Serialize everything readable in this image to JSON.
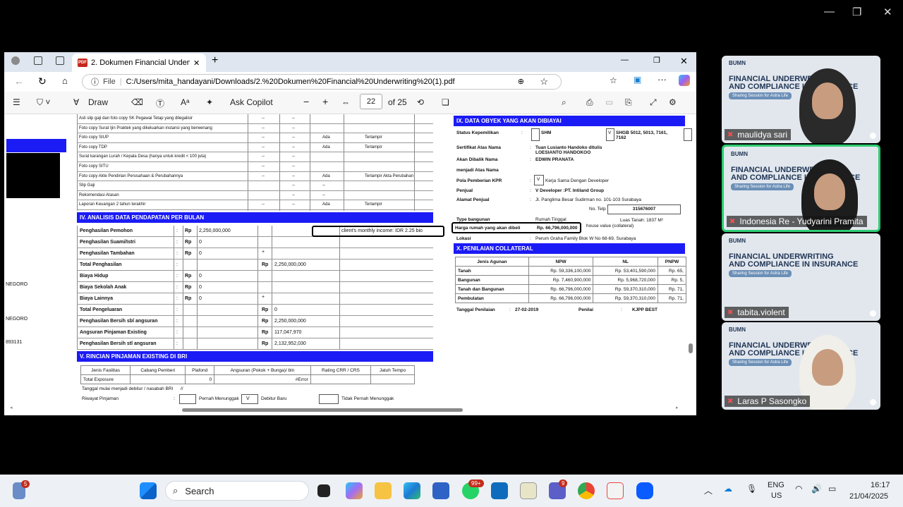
{
  "browser": {
    "tab_title": "2. Dokumen Financial Underwriting",
    "url_prefix": "File",
    "url": "C:/Users/mita_handayani/Downloads/2.%20Dokumen%20Financial%20Underwriting%20(1).pdf"
  },
  "pdf_toolbar": {
    "draw": "Draw",
    "ask_copilot": "Ask Copilot",
    "page": "22",
    "of": "of 25"
  },
  "doc_left": {
    "docs_rows": [
      {
        "label": "Asli slip gaji dan foto copy SK Pegawai Tetap yang dilegalisir",
        "c1": "--",
        "c2": "--",
        "c3": "",
        "c4": ""
      },
      {
        "label": "Foto copy Surat Ijin Praktek yang dikeluarkan instansi yang berwenang",
        "c1": "--",
        "c2": "--",
        "c3": "",
        "c4": ""
      },
      {
        "label": "Foto copy SIUP",
        "c1": "--",
        "c2": "--",
        "c3": "Ada",
        "c4": "Terlampir"
      },
      {
        "label": "Foto copy TDP",
        "c1": "--",
        "c2": "--",
        "c3": "Ada",
        "c4": "Terlampir"
      },
      {
        "label": "Surat karangan Lurah / Kepala Desa (hanya untuk kredit < 100 juta)",
        "c1": "--",
        "c2": "--",
        "c3": "",
        "c4": ""
      },
      {
        "label": "Foto copy SITU",
        "c1": "--",
        "c2": "--",
        "c3": "",
        "c4": ""
      },
      {
        "label": "Foto copy Akte Pendirian Perusahaan & Perubahannya",
        "c1": "--",
        "c2": "--",
        "c3": "Ada",
        "c4": "Terlampir Akta Perubahan"
      },
      {
        "label": "Slip Gaji",
        "c1": "",
        "c2": "--",
        "c3": "--",
        "c4": ""
      },
      {
        "label": "Rekomendasi Atasan",
        "c1": "",
        "c2": "--",
        "c3": "--",
        "c4": ""
      },
      {
        "label": "Laporan Keuangan 2 tahun terakhir",
        "c1": "--",
        "c2": "--",
        "c3": "Ada",
        "c4": "Terlampir"
      }
    ],
    "section4_title": "IV. ANALISIS DATA PENDAPATAN PER BULAN",
    "income_rows": [
      {
        "label": "Penghasilan Pemohon",
        "rp": "Rp",
        "val": "2,250,000,000",
        "op": "",
        "rp2": "",
        "total": ""
      },
      {
        "label": "Penghasilan Suami/Istri",
        "rp": "Rp",
        "val": "0",
        "op": "",
        "rp2": "",
        "total": ""
      },
      {
        "label": "Penghasilan Tambahan",
        "rp": "Rp",
        "val": "0",
        "op": "+",
        "rp2": "",
        "total": ""
      },
      {
        "label": "Total Penghasilan",
        "rp": "",
        "val": "",
        "op": "",
        "rp2": "Rp",
        "total": "2,250,000,000"
      },
      {
        "label": "Biaya Hidup",
        "rp": "Rp",
        "val": "0",
        "op": "",
        "rp2": "",
        "total": ""
      },
      {
        "label": "Biaya Sekolah Anak",
        "rp": "Rp",
        "val": "0",
        "op": "",
        "rp2": "",
        "total": ""
      },
      {
        "label": "Biaya Lainnya",
        "rp": "Rp",
        "val": "0",
        "op": "+",
        "rp2": "",
        "total": ""
      },
      {
        "label": "Total Pengeluaran",
        "rp": "",
        "val": "",
        "op": "",
        "rp2": "Rp",
        "total": "0"
      },
      {
        "label": "Penghasilan Bersih sbl angsuran",
        "rp": "",
        "val": "",
        "op": "",
        "rp2": "Rp",
        "total": "2,250,000,000"
      },
      {
        "label": "Angsuran Pinjaman Existing",
        "rp": "",
        "val": "",
        "op": "",
        "rp2": "Rp",
        "total": "117,047,970"
      },
      {
        "label": "Penghasilan Bersih stl angsuran",
        "rp": "",
        "val": "",
        "op": "",
        "rp2": "Rp",
        "total": "2,132,952,030"
      }
    ],
    "annotation_income": "client's monthly income: IDR 2.25 bio",
    "section5_title": "V. RINCIAN PINJAMAN EXISTING DI BRI",
    "loan_headers": [
      "Jenis Fasilitas",
      "Cabang Pemberi",
      "Plafond",
      "Angsuran (Pokok + Bunga)/ bln",
      "Rating CRR / CRS",
      "Jatuh Tempo"
    ],
    "loan_total": {
      "label": "Total Exposure",
      "plafond": "0",
      "angsuran": "#Error"
    },
    "tanggal_mulai": "Tanggal mulai menjadi debitur / nasabah BRI",
    "tanggal_val": "//",
    "riwayat": "Riwayat Pinjaman",
    "riwayat_opts": [
      "Pernah Menunggak",
      "V",
      "Debitur Baru",
      "Tidak Pernah Menunggak"
    ]
  },
  "margin_left": [
    "NEGORO",
    "NEGORO",
    "893131"
  ],
  "doc_right": {
    "section9_title": "IX. DATA OBYEK YANG AKAN DIBIAYAI",
    "status_label": "Status Kepemilikan",
    "status_val": "SHM",
    "status_v": "V",
    "status_no": "SHGB 5012, 5013, 7161, 7162",
    "sertifikat_label": "Sertifikat Atas Nama",
    "sertifikat_val": "Tuan Lusianto Handoko ditulis LOESIANTO HANDOKOO",
    "akan_label": "Akan Dibalik Nama",
    "akan_val": "EDWIN PRANATA",
    "menjadi_label": "menjadi Atas Nama",
    "pola_label": "Pola Pemberian KPR",
    "pola_v": "V",
    "pola_val": "Kerja Sama Dengan Developer",
    "penjual_label": "Penjual",
    "penjual_val": "V   Developer :PT. Intiland Group",
    "alamat_label": "Alamat Penjual",
    "alamat_val": "Jl. Panglima Besar Sudirman no. 101-103 Surabaya",
    "telp_label": "No. Telp :",
    "telp_val": "315676007",
    "type_label": "Type bangunan",
    "type_val": "Rumah Tinggal",
    "luas_label": "Luas Tanah: 1837 M²",
    "harga_label": "Harga rumah yang akan dibeli",
    "harga_val": "Rp. 66,796,000,000",
    "harga_note": "house value (collateral)",
    "lokasi_label": "Lokasi",
    "lokasi_val": "Perum Graha Family Blok W No 68-69, Surabaya",
    "section10_title": "X. PENILAIAN COLLATERAL",
    "coll_headers": [
      "Jenis Agunan",
      "NPW",
      "NL",
      "PNPW"
    ],
    "coll_rows": [
      [
        "Tanah",
        "Rp. 59,336,100,000",
        "Rp. 53,401,590,000",
        "Rp. 65,"
      ],
      [
        "Bangunan",
        "Rp. 7,460,900,000",
        "Rp. 5,968,720,000",
        "Rp. 5,"
      ],
      [
        "Tanah dan Bangunan",
        "Rp. 66,796,000,000",
        "Rp. 59,370,310,000",
        "Rp. 71,"
      ],
      [
        "Pembulatan",
        "Rp. 66,796,000,000",
        "Rp. 59,370,310,000",
        "Rp. 71,"
      ]
    ],
    "tgl_label": "Tanggal Penilaian",
    "tgl_val": "27-02-2019",
    "penilai_label": "Penilai",
    "penilai_val": "KJPP BEST"
  },
  "zoom_tiles": [
    {
      "name": "maulidya sari"
    },
    {
      "name": "Indonesia Re - Yudyarini Pramita"
    },
    {
      "name": "tabita.violent"
    },
    {
      "name": "Laras P Sasongko"
    }
  ],
  "slide": {
    "title1": "FINANCIAL UNDERWRITING",
    "title2": "AND COMPLIANCE IN INSURANCE",
    "sub": "Sharing Session for Astra Life",
    "logo": "BUMN"
  },
  "taskbar": {
    "search": "Search",
    "lang1": "ENG",
    "lang2": "US",
    "time": "16:17",
    "date": "21/04/2025",
    "badge_bell": "5",
    "badge_wa": "99+",
    "badge_teams": "9"
  },
  "colors": {
    "accent_blue": "#1b1bf5",
    "zoom_active": "#2ecc71"
  }
}
